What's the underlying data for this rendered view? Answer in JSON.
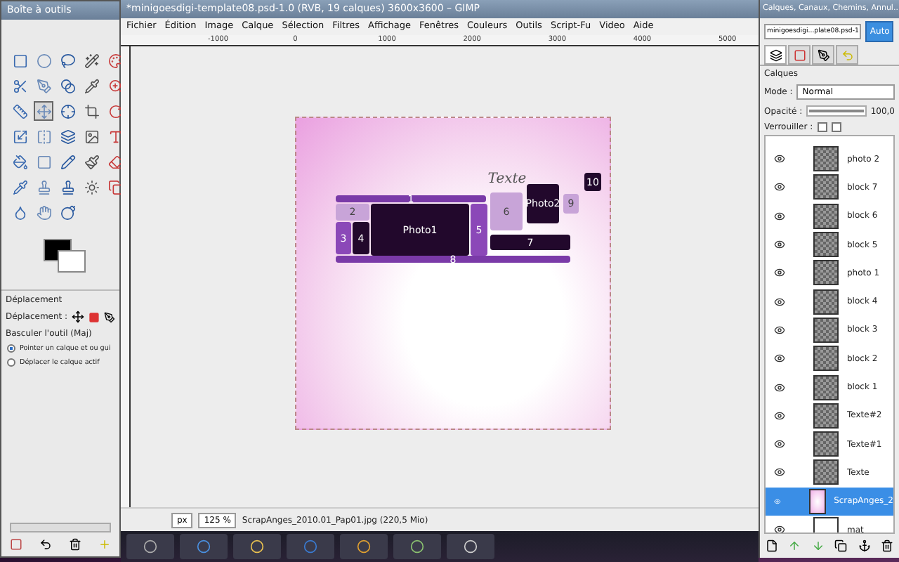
{
  "toolbox": {
    "title": "Boîte à outils",
    "options_title": "Déplacement",
    "move_label": "Déplacement :",
    "toggle_label": "Basculer l'outil  (Maj)",
    "radios": [
      {
        "label": "Pointer un calque et ou gui",
        "selected": true
      },
      {
        "label": "Déplacer le calque actif",
        "selected": false
      }
    ]
  },
  "image_window": {
    "title": "*minigoesdigi-template08.psd-1.0 (RVB, 19 calques) 3600x3600 – GIMP",
    "menu": [
      "Fichier",
      "Édition",
      "Image",
      "Calque",
      "Sélection",
      "Filtres",
      "Affichage",
      "Fenêtres",
      "Couleurs",
      "Outils",
      "Script-Fu",
      "Video",
      "Aide"
    ],
    "ruler_labels": [
      "-1000",
      "0",
      "1000",
      "2000",
      "3000",
      "4000",
      "5000"
    ],
    "template_blocks": [
      {
        "label": "Texte",
        "kind": "script"
      },
      {
        "label": "10",
        "kind": "dark"
      },
      {
        "label": "Photo2",
        "kind": "dark"
      },
      {
        "label": "6",
        "kind": "light"
      },
      {
        "label": "9",
        "kind": "light"
      },
      {
        "label": "1",
        "kind": "bar"
      },
      {
        "label": "2",
        "kind": "light"
      },
      {
        "label": "Photo1",
        "kind": "dark"
      },
      {
        "label": "5",
        "kind": "mid"
      },
      {
        "label": "3",
        "kind": "mid"
      },
      {
        "label": "4",
        "kind": "dark"
      },
      {
        "label": "7",
        "kind": "dark"
      },
      {
        "label": "8",
        "kind": "bar"
      }
    ],
    "status": {
      "unit": "px",
      "zoom": "125 %",
      "info": "ScrapAnges_2010.01_Pap01.jpg (220,5 Mio)"
    }
  },
  "dock": {
    "title": "Calques, Canaux, Chemins, Annul...",
    "image": "minigoesdigi...plate08.psd-1",
    "auto_button": "Auto",
    "panel_title": "Calques",
    "mode_label": "Mode :",
    "mode": "Normal",
    "opacity_label": "Opacité :",
    "opacity": {
      "level": 1.0,
      "reading": "100,0"
    },
    "lock_label": "Verrouiller :",
    "locks": [
      {
        "checked": false
      },
      {
        "checked": false
      }
    ],
    "layers": [
      {
        "name": "photo 2",
        "kind": "transparent",
        "selected": false
      },
      {
        "name": "block 7",
        "kind": "transparent",
        "selected": false
      },
      {
        "name": "block 6",
        "kind": "transparent",
        "selected": false
      },
      {
        "name": "block 5",
        "kind": "transparent",
        "selected": false
      },
      {
        "name": "photo 1",
        "kind": "transparent",
        "selected": false
      },
      {
        "name": "block 4",
        "kind": "transparent",
        "selected": false
      },
      {
        "name": "block 3",
        "kind": "transparent",
        "selected": false
      },
      {
        "name": "block 2",
        "kind": "transparent",
        "selected": false
      },
      {
        "name": "block 1",
        "kind": "transparent",
        "selected": false
      },
      {
        "name": "Texte#2",
        "kind": "transparent",
        "selected": false
      },
      {
        "name": "Texte#1",
        "kind": "transparent",
        "selected": false
      },
      {
        "name": "Texte",
        "kind": "transparent",
        "selected": false
      },
      {
        "name": "ScrapAnges_2",
        "kind": "paper",
        "selected": true
      },
      {
        "name": "mat",
        "kind": "white",
        "selected": false
      }
    ]
  }
}
